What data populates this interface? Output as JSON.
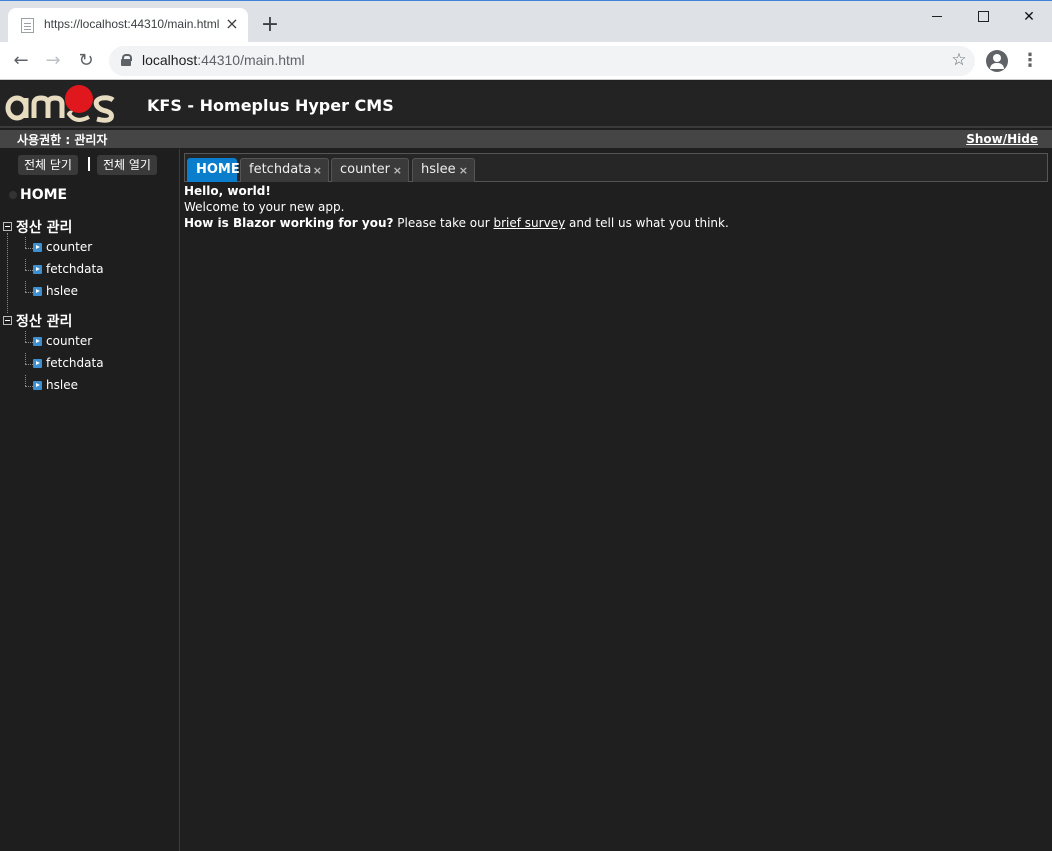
{
  "browser": {
    "tab_title": "https://localhost:44310/main.html",
    "tab_close": "×",
    "new_tab": "+",
    "url_host": "localhost",
    "url_rest": ":44310/main.html"
  },
  "app": {
    "title": "KFS - Homeplus Hyper CMS",
    "logo_text": "amos",
    "permission_label": "사용권한 : 관리자",
    "show_hide": "Show/Hide"
  },
  "sidebar": {
    "close_all": "전체 닫기",
    "open_all": "전체 열기",
    "home": "HOME",
    "groups": [
      {
        "label": "정산 관리",
        "items": [
          "counter",
          "fetchdata",
          "hslee"
        ]
      },
      {
        "label": "정산 관리",
        "items": [
          "counter",
          "fetchdata",
          "hslee"
        ]
      }
    ]
  },
  "content": {
    "tabs": [
      {
        "label": "HOME",
        "active": true,
        "closable": false
      },
      {
        "label": "fetchdata",
        "active": false,
        "closable": true
      },
      {
        "label": "counter",
        "active": false,
        "closable": true
      },
      {
        "label": "hslee",
        "active": false,
        "closable": true
      }
    ],
    "tab_close_glyph": "×",
    "heading": "Hello, world!",
    "welcome": "Welcome to your new app.",
    "survey_question": "How is Blazor working for you?",
    "survey_pre": " Please take our ",
    "survey_link": "brief survey",
    "survey_post": " and tell us what you think."
  },
  "colors": {
    "accent": "#0a7ecc",
    "logo_red": "#e1171e",
    "logo_cream": "#e8dcc0"
  }
}
